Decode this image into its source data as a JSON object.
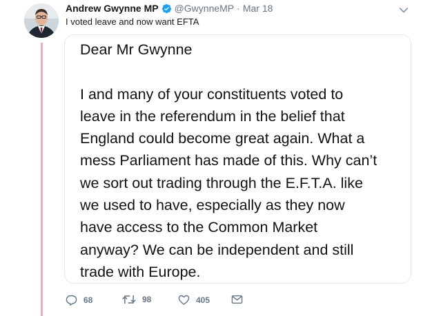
{
  "tweet": {
    "display_name": "Andrew Gwynne MP",
    "handle": "@GwynneMP",
    "separator": "·",
    "date": "Mar 18",
    "text": "I voted leave and now want EFTA"
  },
  "letter": {
    "salutation": "Dear Mr Gwynne",
    "body_lines": [
      "I and many of your constituents voted to",
      "leave in the referendum in the belief that",
      "England could become great again. What a",
      "mess Parliament has made of this. Why can’t",
      "we sort out trading through the E.F.T.A. like",
      "we used to have, especially as they now",
      "have access to the Common Market",
      "anyway? We can be independent and still",
      "trade with Europe."
    ]
  },
  "actions": {
    "reply_count": "68",
    "retweet_count": "98",
    "like_count": "405"
  },
  "icons": {
    "verified": "verified-badge-icon",
    "caret": "chevron-down-icon",
    "reply": "reply-icon",
    "retweet": "retweet-icon",
    "like": "heart-icon",
    "message": "envelope-icon"
  },
  "colors": {
    "thread_line": "#f4a9b3",
    "verified_blue": "#1da1f2",
    "muted": "#657786"
  }
}
